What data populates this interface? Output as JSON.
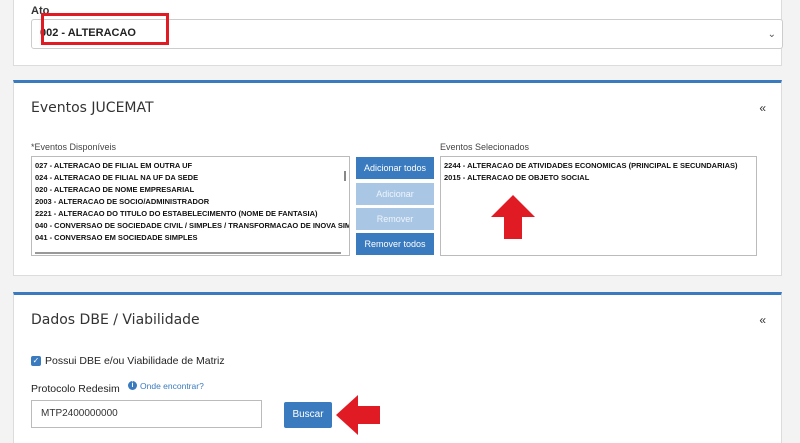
{
  "ato": {
    "label": "Ato",
    "selected": "002 - ALTERACAO"
  },
  "eventos": {
    "title": "Eventos JUCEMAT",
    "collapse": "«",
    "available_label": "*Eventos Disponíveis",
    "selected_label": "Eventos Selecionados",
    "available_items": [
      "027 - ALTERACAO DE FILIAL EM OUTRA UF",
      "024 - ALTERACAO DE FILIAL NA UF DA SEDE",
      "020 - ALTERACAO DE NOME EMPRESARIAL",
      "2003 - ALTERACAO DE SOCIO/ADMINISTRADOR",
      "2221 - ALTERACAO DO TITULO DO ESTABELECIMENTO (NOME DE FANTASIA)",
      "040 - CONVERSAO DE SOCIEDADE CIVIL / SIMPLES / TRANSFORMACAO DE INOVA SIMP",
      "041 - CONVERSAO EM SOCIEDADE SIMPLES"
    ],
    "selected_items": [
      "2244 - ALTERACAO DE ATIVIDADES ECONOMICAS (PRINCIPAL E SECUNDARIAS)",
      "2015 - ALTERACAO DE OBJETO SOCIAL"
    ],
    "buttons": {
      "add_all": "Adicionar todos",
      "add": "Adicionar",
      "remove": "Remover",
      "remove_all": "Remover todos"
    }
  },
  "dados": {
    "title": "Dados DBE / Viabilidade",
    "collapse": "«",
    "checkbox_label": "Possui DBE e/ou Viabilidade de Matriz",
    "protocolo_label": "Protocolo Redesim",
    "info_link": "Onde encontrar?",
    "protocolo_value": "MTP2400000000",
    "buscar": "Buscar"
  },
  "colors": {
    "accent": "#3a7bbf",
    "highlight": "#e01b24"
  }
}
